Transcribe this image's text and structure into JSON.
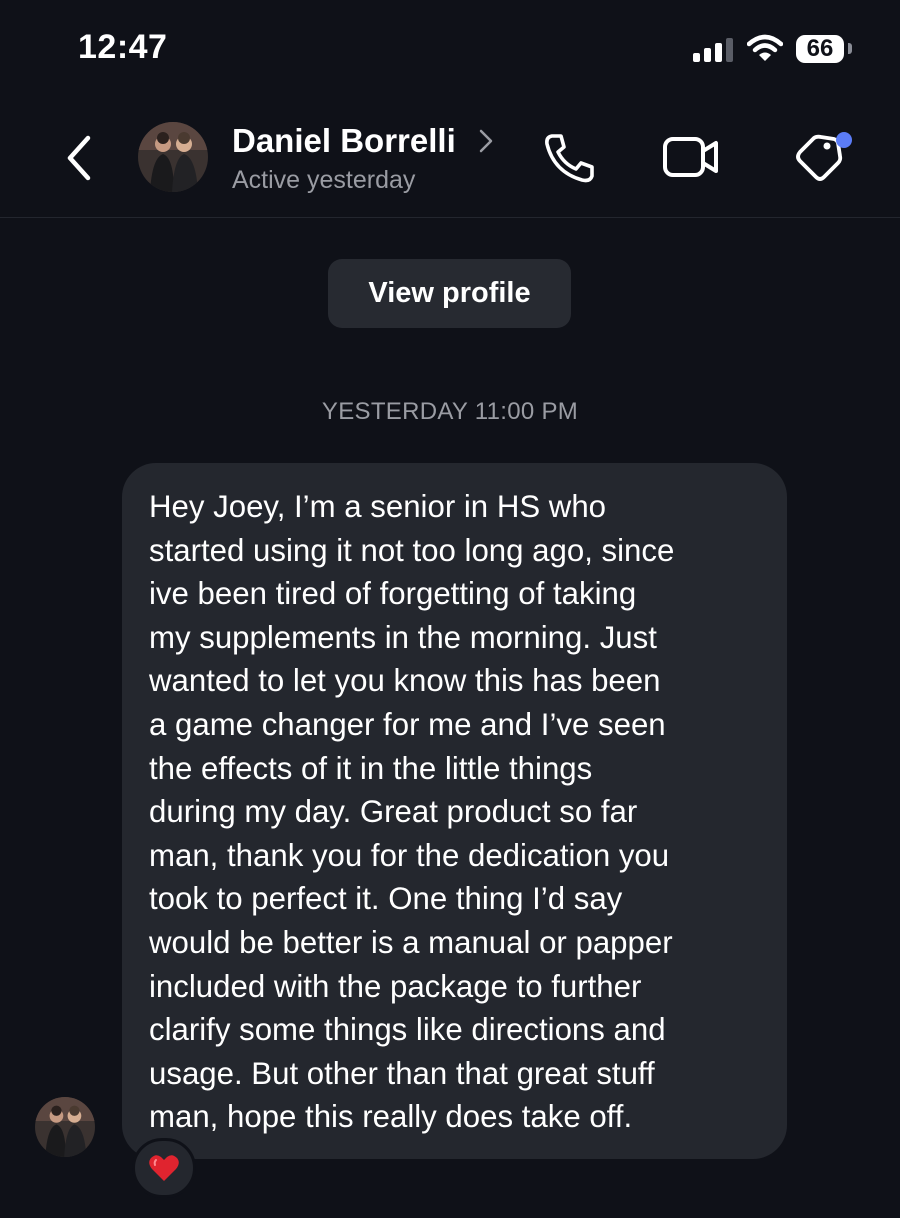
{
  "status_bar": {
    "time": "12:47",
    "battery": "66"
  },
  "header": {
    "contact_name": "Daniel Borrelli",
    "contact_status": "Active yesterday",
    "icons": [
      "back-icon",
      "avatar",
      "chevron-right-icon",
      "phone-icon",
      "video-camera-icon",
      "tag-icon"
    ],
    "notification_dot_color": "#5b7cf6"
  },
  "profile_button": {
    "label": "View profile"
  },
  "conversation": {
    "timestamp": "YESTERDAY 11:00 PM",
    "message": {
      "text": "Hey Joey, I’m a senior in HS who\nstarted using it not too long ago, since\nive been tired of forgetting of taking\nmy supplements in the morning. Just\nwanted to let you know this has been\na game changer for me and I’ve seen\nthe effects of it in the little things\nduring my day. Great product so far\nman, thank you for the dedication you\ntook to perfect it. One thing I’d say\nwould be better is a manual or papper\nincluded with the package to further\nclarify some things like directions and\nusage. But other than that great stuff\nman, hope this really does take off.",
      "reaction": "heart-icon"
    }
  },
  "colors": {
    "background": "#0f1118",
    "bubble": "#24272e",
    "secondary_text": "#9a9ca3",
    "reaction_heart": "#e0242f"
  }
}
